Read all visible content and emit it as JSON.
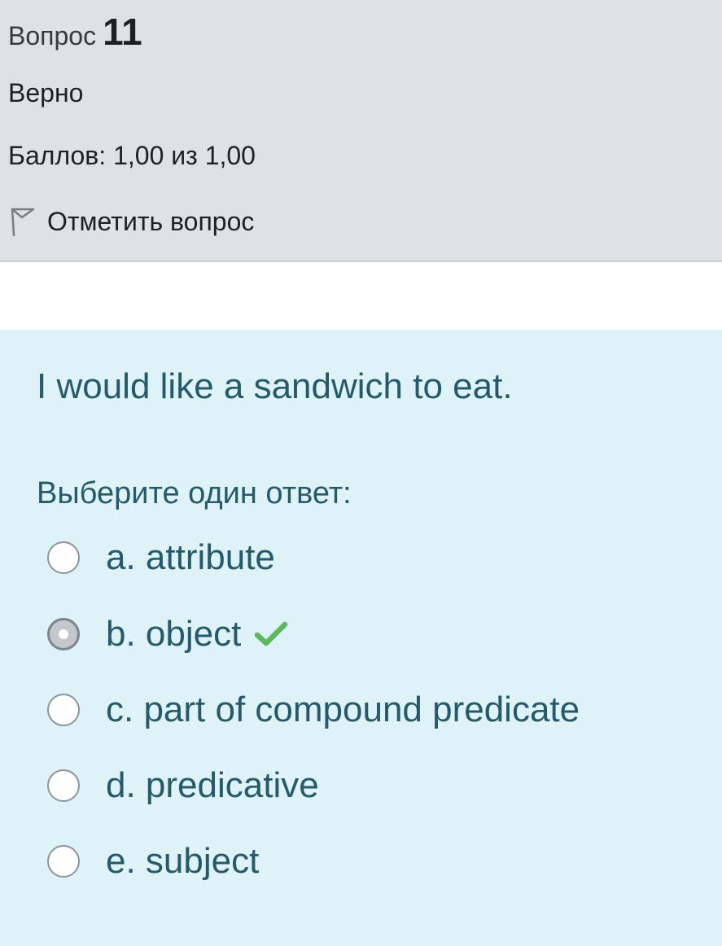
{
  "question_info": {
    "label": "Вопрос",
    "number": "11",
    "state": "Верно",
    "grade": "Баллов: 1,00 из 1,00",
    "flag_label": "Отметить вопрос",
    "flag_icon": "flag-outline-icon"
  },
  "question": {
    "text": "I would like a sandwich to eat.",
    "prompt": "Выберите один ответ:",
    "answers": [
      {
        "label": "a. attribute",
        "selected": false
      },
      {
        "label": "b. object",
        "selected": true,
        "marked_correct": true
      },
      {
        "label": "c. part of compound predicate",
        "selected": false
      },
      {
        "label": "d. predicative",
        "selected": false
      },
      {
        "label": "e. subject",
        "selected": false
      }
    ],
    "correct_icon": "checkmark-icon"
  },
  "colors": {
    "info_background": "#dee2e6",
    "question_background": "#def2f8",
    "question_text": "#245b6b",
    "check_green": "#5cb85c"
  }
}
